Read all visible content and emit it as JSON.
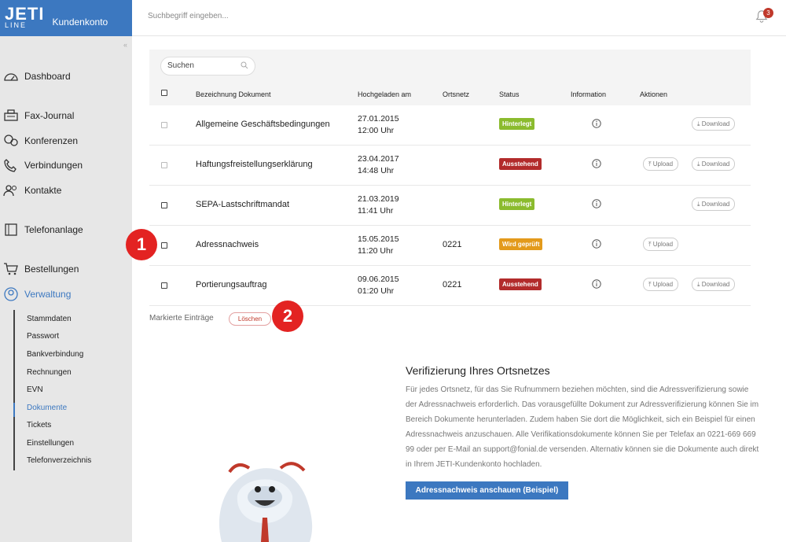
{
  "brand": {
    "logo": "JETI",
    "logo_sub": "LINE",
    "subtitle": "Kundenkonto"
  },
  "topbar": {
    "search_placeholder": "Suchbegriff eingeben...",
    "notifications": "3"
  },
  "sidebar": {
    "collapse": "«",
    "items": [
      {
        "label": "Dashboard",
        "icon": "dashboard-icon"
      },
      {
        "label": "Fax-Journal",
        "icon": "fax-icon"
      },
      {
        "label": "Konferenzen",
        "icon": "conference-icon"
      },
      {
        "label": "Verbindungen",
        "icon": "phone-icon"
      },
      {
        "label": "Kontakte",
        "icon": "contacts-icon"
      },
      {
        "label": "Telefonanlage",
        "icon": "pbx-icon"
      },
      {
        "label": "Bestellungen",
        "icon": "cart-icon"
      },
      {
        "label": "Verwaltung",
        "icon": "user-circle-icon"
      }
    ],
    "subitems": [
      "Stammdaten",
      "Passwort",
      "Bankverbindung",
      "Rechnungen",
      "EVN",
      "Dokumente",
      "Tickets",
      "Einstellungen",
      "Telefonverzeichnis"
    ]
  },
  "table": {
    "search_label": "Suchen",
    "headers": {
      "name": "Bezeichnung Dokument",
      "uploaded": "Hochgeladen am",
      "ortsnetz": "Ortsnetz",
      "status": "Status",
      "info": "Information",
      "actions": "Aktionen"
    },
    "rows": [
      {
        "name": "Allgemeine Geschäftsbedingungen",
        "date": "27.01.2015",
        "time": "12:00 Uhr",
        "ortsnetz": "",
        "status": "Hinterlegt",
        "status_color": "#8bbb2e",
        "upload": "",
        "download": "Download"
      },
      {
        "name": "Haftungsfreistellungserklärung",
        "date": "23.04.2017",
        "time": "14:48 Uhr",
        "ortsnetz": "",
        "status": "Ausstehend",
        "status_color": "#b22b2b",
        "upload": "Upload",
        "download": "Download"
      },
      {
        "name": "SEPA-Lastschriftmandat",
        "date": "21.03.2019",
        "time": "11:41 Uhr",
        "ortsnetz": "",
        "status": "Hinterlegt",
        "status_color": "#8bbb2e",
        "upload": "",
        "download": "Download"
      },
      {
        "name": "Adressnachweis",
        "date": "15.05.2015",
        "time": "11:20 Uhr",
        "ortsnetz": "0221",
        "status": "Wird geprüft",
        "status_color": "#e39a1b",
        "upload": "Upload",
        "download": ""
      },
      {
        "name": "Portierungsauftrag",
        "date": "09.06.2015",
        "time": "01:20 Uhr",
        "ortsnetz": "0221",
        "status": "Ausstehend",
        "status_color": "#b22b2b",
        "upload": "Upload",
        "download": "Download"
      }
    ],
    "marked_label": "Markierte Einträge",
    "delete_label": "Löschen"
  },
  "callouts": [
    "1",
    "2"
  ],
  "verify": {
    "title": "Verifizierung Ihres Ortsnetzes",
    "text": "Für jedes Ortsnetz, für das Sie Rufnummern beziehen möchten, sind die Adressverifizierung sowie der Adressnachweis erforderlich. Das vorausgefüllte Dokument zur Adressverifizierung können Sie im Bereich Dokumente herunterladen. Zudem haben Sie dort die Möglichkeit, sich ein Beispiel für einen Adressnachweis anzuschauen. Alle Verifikationsdokumente können Sie per Telefax an 0221-669 669 99 oder per E-Mail an support@fonial.de versenden. Alternativ können sie die Dokumente auch direkt in Ihrem JETI-Kundenkonto hochladen.",
    "button": "Adressnachweis anschauen (Beispiel)"
  },
  "colors": {
    "brand": "#3c78c0",
    "sidebar": "#e7e7e7",
    "callout": "#e32322"
  }
}
